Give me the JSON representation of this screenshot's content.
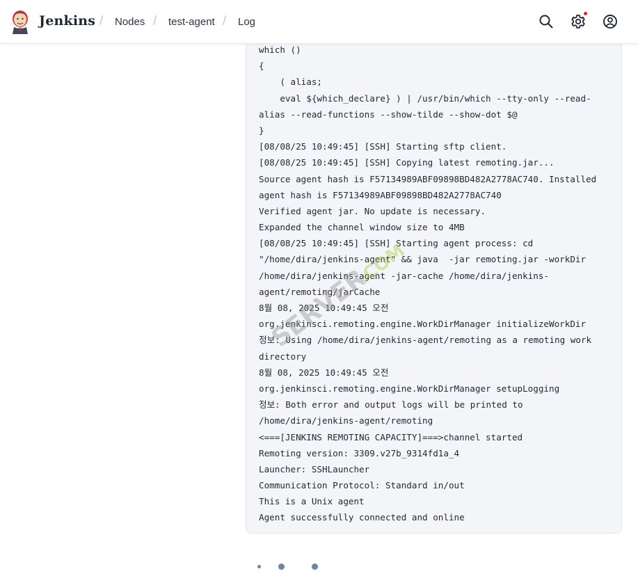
{
  "header": {
    "brand": "Jenkins",
    "breadcrumbs": [
      "Nodes",
      "test-agent",
      "Log"
    ],
    "separator": "/",
    "icons": [
      "jenkins-logo-icon",
      "search-icon",
      "gear-icon",
      "user-icon"
    ],
    "notification_color": "#e41e1e"
  },
  "console": {
    "lines": [
      "which ()",
      "{",
      "    ( alias;",
      "    eval ${which_declare} ) | /usr/bin/which --tty-only --read-",
      "alias --read-functions --show-tilde --show-dot $@",
      "}",
      "[08/08/25 10:49:45] [SSH] Starting sftp client.",
      "[08/08/25 10:49:45] [SSH] Copying latest remoting.jar...",
      "Source agent hash is F57134989ABF09898BD482A2778AC740. Installed",
      "agent hash is F57134989ABF09898BD482A2778AC740",
      "Verified agent jar. No update is necessary.",
      "Expanded the channel window size to 4MB",
      "[08/08/25 10:49:45] [SSH] Starting agent process: cd",
      "\"/home/dira/jenkins-agent\" && java  -jar remoting.jar -workDir",
      "/home/dira/jenkins-agent -jar-cache /home/dira/jenkins-",
      "agent/remoting/jarCache",
      "8월 08, 2025 10:49:45 오전",
      "org.jenkinsci.remoting.engine.WorkDirManager initializeWorkDir",
      "정보: Using /home/dira/jenkins-agent/remoting as a remoting work",
      "directory",
      "8월 08, 2025 10:49:45 오전",
      "org.jenkinsci.remoting.engine.WorkDirManager setupLogging",
      "정보: Both error and output logs will be printed to",
      "/home/dira/jenkins-agent/remoting",
      "<===[JENKINS REMOTING CAPACITY]===>channel started",
      "Remoting version: 3309.v27b_9314fd1a_4",
      "Launcher: SSHLauncher",
      "Communication Protocol: Standard in/out",
      "This is a Unix agent",
      "Agent successfully connected and online"
    ]
  },
  "watermark": {
    "text": "SERVER.COM",
    "colors": [
      "#9a9a9a",
      "#a8d34a"
    ]
  },
  "spinner": {
    "icon": "loading-dots-icon",
    "color": "#6f84a8"
  }
}
